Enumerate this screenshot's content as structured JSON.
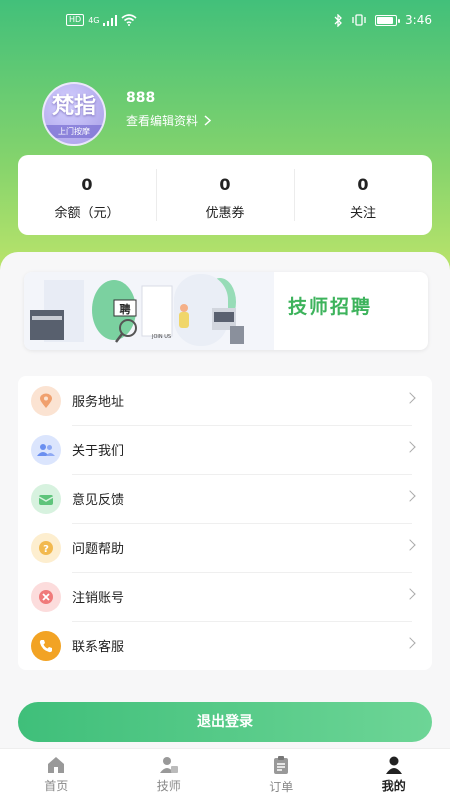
{
  "status_bar": {
    "time": "3:46",
    "hd_badge": "HD",
    "network": "4G",
    "battery_level": 0.9
  },
  "profile": {
    "avatar_title": "梵指",
    "avatar_subtitle": "上门按摩",
    "username": "888",
    "edit_link": "查看编辑资料"
  },
  "stats": [
    {
      "value": "0",
      "label": "余额（元）"
    },
    {
      "value": "0",
      "label": "优惠券"
    },
    {
      "value": "0",
      "label": "关注"
    }
  ],
  "banner": {
    "title": "技师招聘",
    "sign_text": "聘",
    "door_text": "JOIN US"
  },
  "menu": [
    {
      "label": "服务地址",
      "icon": "location-icon",
      "color": "#f0a06e",
      "bg": "#fbe3d2"
    },
    {
      "label": "关于我们",
      "icon": "users-icon",
      "color": "#6a8ff0",
      "bg": "#dbe5fd"
    },
    {
      "label": "意见反馈",
      "icon": "feedback-icon",
      "color": "#5ec47b",
      "bg": "#d7f2df"
    },
    {
      "label": "问题帮助",
      "icon": "help-icon",
      "color": "#f2b94f",
      "bg": "#fdeecf"
    },
    {
      "label": "注销账号",
      "icon": "close-icon",
      "color": "#f07a7a",
      "bg": "#fcdcdc"
    },
    {
      "label": "联系客服",
      "icon": "phone-icon",
      "color": "#ffffff",
      "bg": "#f2a324"
    }
  ],
  "logout_label": "退出登录",
  "tabs": [
    {
      "label": "首页",
      "icon": "home-icon",
      "active": false
    },
    {
      "label": "技师",
      "icon": "technician-icon",
      "active": false
    },
    {
      "label": "订单",
      "icon": "order-icon",
      "active": false
    },
    {
      "label": "我的",
      "icon": "profile-icon",
      "active": true
    }
  ],
  "colors": {
    "brand_green": "#42c07a",
    "accent_green": "#3db35c"
  }
}
